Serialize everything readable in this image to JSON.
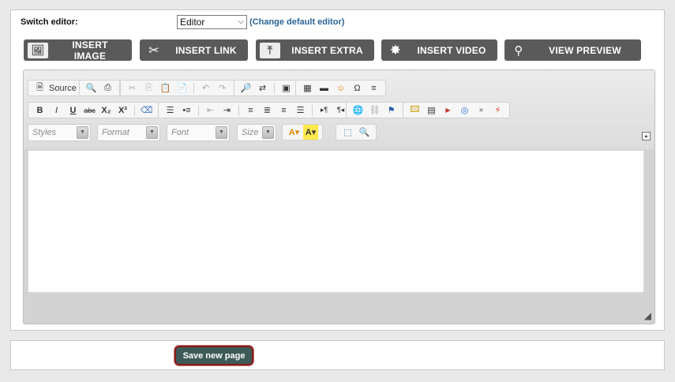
{
  "switch_editor": {
    "label": "Switch editor:",
    "selected": "Editor",
    "change_link": "(Change default editor)"
  },
  "top_buttons": [
    {
      "label": "INSERT IMAGE",
      "icon": "image-icon"
    },
    {
      "label": "INSERT LINK",
      "icon": "link-icon"
    },
    {
      "label": "INSERT EXTRA",
      "icon": "upload-icon"
    },
    {
      "label": "INSERT VIDEO",
      "icon": "film-reel-icon"
    },
    {
      "label": "VIEW PREVIEW",
      "icon": "magnifier-icon"
    }
  ],
  "toolbar": {
    "source_label": "Source",
    "styles_placeholder": "Styles",
    "format_placeholder": "Format",
    "font_placeholder": "Font",
    "size_placeholder": "Size",
    "bold": "B",
    "italic": "I",
    "underline": "U",
    "strike": "abc",
    "omega": "Ω"
  },
  "footer": {
    "save_label": "Save new page"
  }
}
